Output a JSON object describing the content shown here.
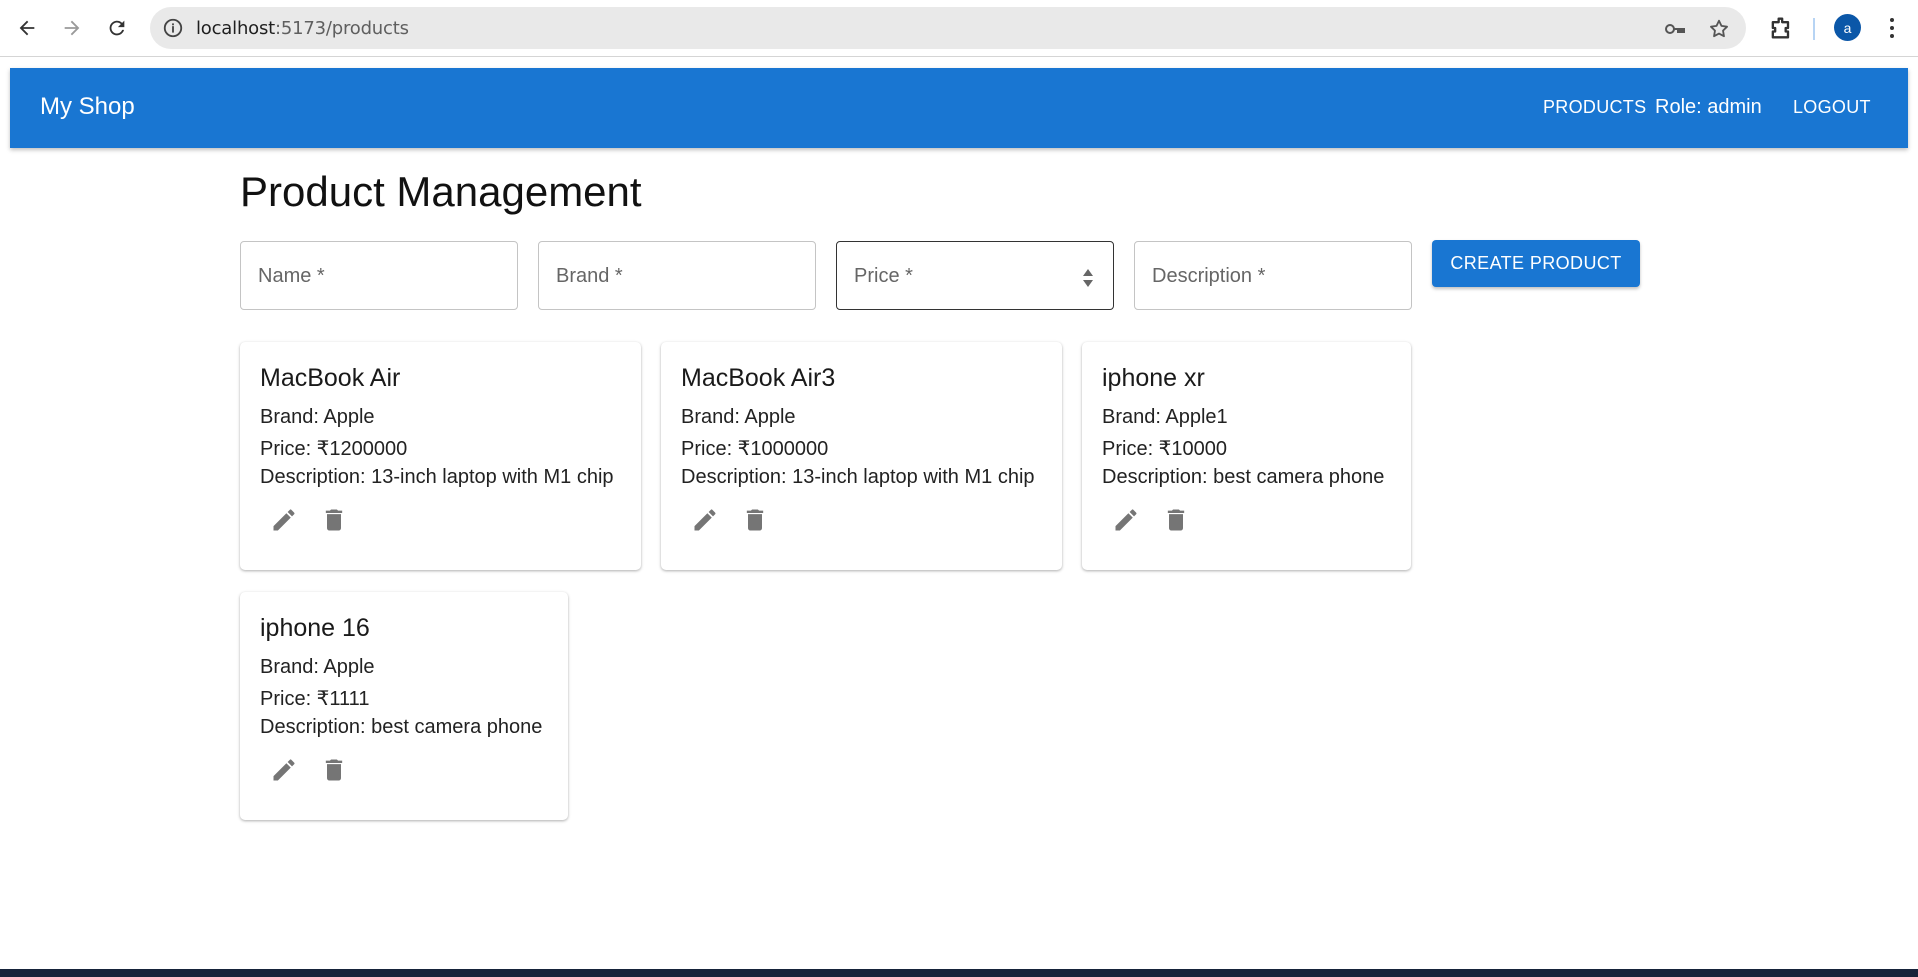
{
  "browser": {
    "url_host": "localhost",
    "url_path": ":5173/products",
    "profile_initial": "a",
    "icons": [
      "back-arrow-icon",
      "forward-arrow-icon",
      "reload-icon",
      "site-info-icon",
      "password-key-icon",
      "bookmark-star-icon",
      "extensions-icon",
      "more-menu-icon"
    ]
  },
  "appbar": {
    "brand": "My Shop",
    "nav_products": "PRODUCTS",
    "role": "Role: admin",
    "logout": "LOGOUT",
    "color": "#1976d2"
  },
  "main": {
    "title": "Product Management",
    "form": {
      "name_placeholder": "Name *",
      "brand_placeholder": "Brand *",
      "price_placeholder": "Price *",
      "description_placeholder": "Description *",
      "create_label": "CREATE PRODUCT"
    },
    "products": [
      {
        "title": "MacBook Air",
        "brand": "Brand: Apple",
        "price": "Price: ₹1200000",
        "description": "Description: 13-inch laptop with M1 chip"
      },
      {
        "title": "MacBook Air3",
        "brand": "Brand: Apple",
        "price": "Price: ₹1000000",
        "description": "Description: 13-inch laptop with M1 chip"
      },
      {
        "title": "iphone xr",
        "brand": "Brand: Apple1",
        "price": "Price: ₹10000",
        "description": "Description: best camera phone"
      },
      {
        "title": "iphone 16",
        "brand": "Brand: Apple",
        "price": "Price: ₹1111",
        "description": "Description: best camera phone"
      }
    ],
    "action_icons": [
      "edit-pencil-icon",
      "delete-trash-icon"
    ],
    "icon_color": "#757575"
  }
}
